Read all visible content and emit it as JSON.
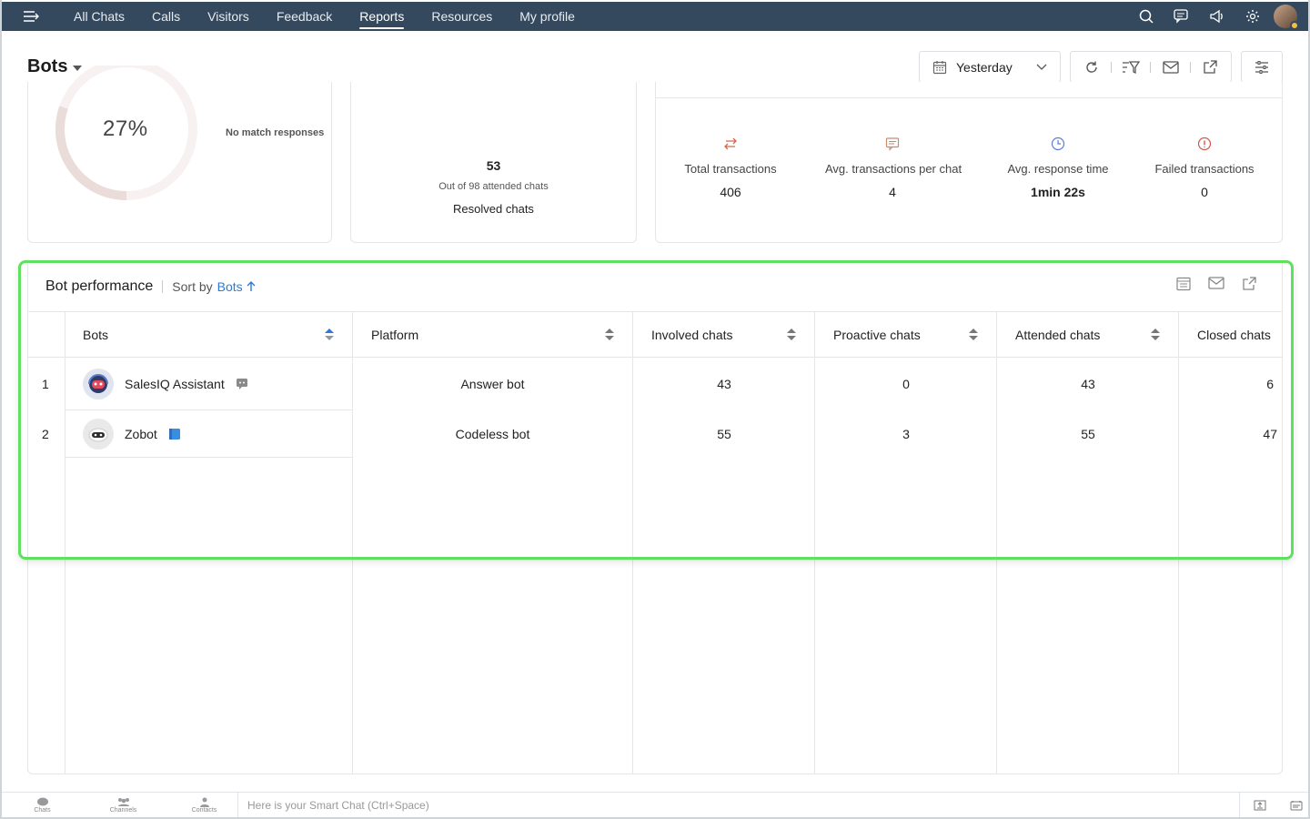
{
  "nav": {
    "items": [
      {
        "label": "All Chats"
      },
      {
        "label": "Calls"
      },
      {
        "label": "Visitors"
      },
      {
        "label": "Feedback"
      },
      {
        "label": "Reports"
      },
      {
        "label": "Resources"
      },
      {
        "label": "My profile"
      }
    ],
    "active": "Reports"
  },
  "page": {
    "title": "Bots",
    "date_filter": "Yesterday"
  },
  "summary": {
    "no_match_percent": "27%",
    "no_match_label": "No match responses",
    "resolved_count": "53",
    "resolved_sub": "Out of 98 attended chats",
    "resolved_label": "Resolved chats",
    "metrics": [
      {
        "label": "Total transactions",
        "value": "406",
        "icon": "transfer-icon"
      },
      {
        "label": "Avg. transactions per chat",
        "value": "4",
        "icon": "message-icon"
      },
      {
        "label": "Avg. response time",
        "value": "1min 22s",
        "icon": "clock-icon"
      },
      {
        "label": "Failed transactions",
        "value": "0",
        "icon": "info-icon"
      }
    ]
  },
  "performance": {
    "title": "Bot performance",
    "sort_by_label": "Sort by",
    "sort_by_value": "Bots",
    "columns": [
      "Bots",
      "Platform",
      "Involved chats",
      "Proactive chats",
      "Attended chats",
      "Closed chats"
    ],
    "rows": [
      {
        "index": "1",
        "bot": "SalesIQ Assistant",
        "platform": "Answer bot",
        "involved": "43",
        "proactive": "0",
        "attended": "43",
        "closed": "6"
      },
      {
        "index": "2",
        "bot": "Zobot",
        "platform": "Codeless bot",
        "involved": "55",
        "proactive": "3",
        "attended": "55",
        "closed": "47"
      }
    ]
  },
  "footer": {
    "items": [
      "Chats",
      "Channels",
      "Contacts"
    ],
    "smart_chat_placeholder": "Here is your Smart Chat (Ctrl+Space)"
  },
  "colors": {
    "nav_bg": "#34495e",
    "accent": "#2b7bd6",
    "highlight": "#5fe05f"
  }
}
